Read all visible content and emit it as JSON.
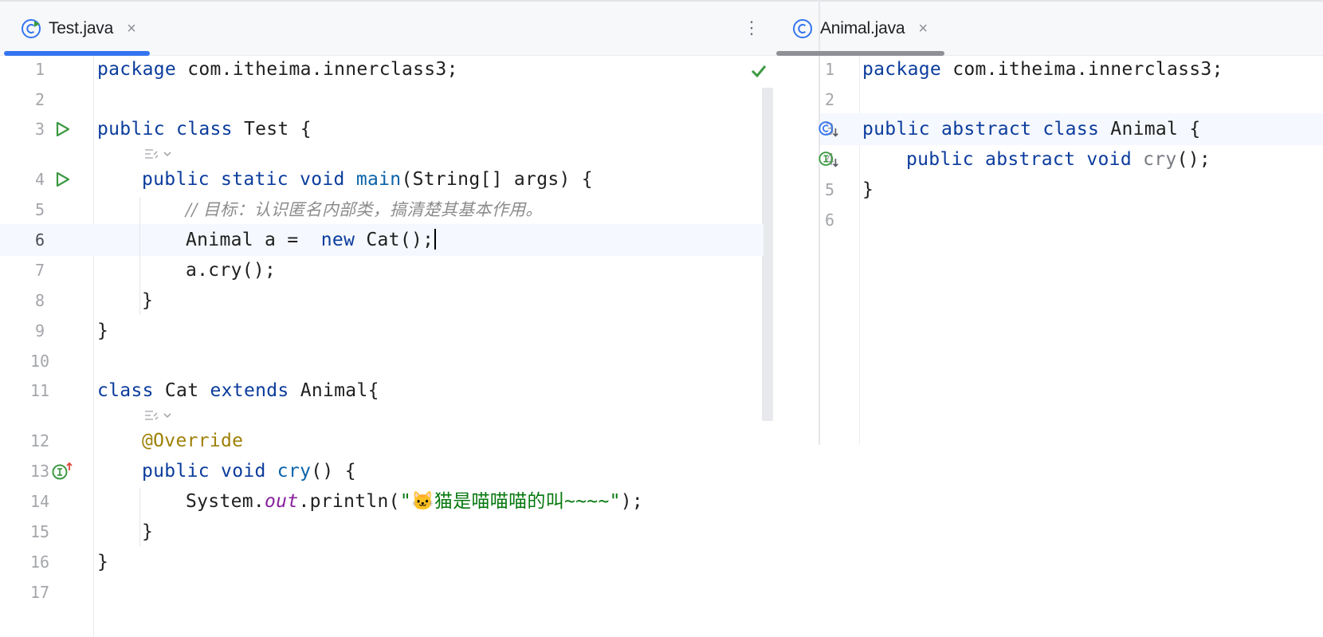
{
  "left_pane": {
    "tab": {
      "label": "Test.java",
      "close": "×",
      "icon": "java-class-runnable-icon",
      "active": true,
      "underline_color": "#3574f0"
    },
    "more_button": "⋮",
    "status_icon": "check-icon",
    "lines": [
      {
        "number": "1",
        "parts": [
          [
            "kw",
            "package"
          ],
          [
            "",
            "com.itheima.innerclass3;"
          ]
        ]
      },
      {
        "number": "2",
        "parts": []
      },
      {
        "number": "3",
        "gutter": "run-icon",
        "parts": [
          [
            "kw",
            "public"
          ],
          [
            "kw",
            "class"
          ],
          [
            "",
            "Test {"
          ]
        ]
      },
      {
        "number": "4",
        "gutter": "run-icon",
        "parts": [
          [
            "kw",
            "public"
          ],
          [
            "kw",
            "static"
          ],
          [
            "kw",
            "void"
          ],
          [
            "fn",
            "main"
          ],
          [
            "",
            "(String[] args) {"
          ]
        ]
      },
      {
        "number": "5",
        "parts": [
          [
            "comment",
            "// 目标：认识匿名内部类，搞清楚其基本作用。"
          ]
        ]
      },
      {
        "number": "6",
        "current": true,
        "parts": [
          [
            "",
            "Animal a = "
          ],
          [
            "kw",
            "new"
          ],
          [
            "",
            "Cat();"
          ]
        ]
      },
      {
        "number": "7",
        "parts": [
          [
            "",
            "a.cry();"
          ]
        ]
      },
      {
        "number": "8",
        "parts": [
          [
            "",
            "}"
          ]
        ]
      },
      {
        "number": "9",
        "parts": [
          [
            "",
            "}"
          ]
        ]
      },
      {
        "number": "10",
        "parts": []
      },
      {
        "number": "11",
        "parts": [
          [
            "kw",
            "class"
          ],
          [
            "",
            "Cat"
          ],
          [
            "kw",
            "extends"
          ],
          [
            "",
            "Animal{"
          ]
        ]
      },
      {
        "number": "12",
        "parts": [
          [
            "anno",
            "@Override"
          ]
        ]
      },
      {
        "number": "13",
        "gutter": "implements-up-icon",
        "parts": [
          [
            "kw",
            "public"
          ],
          [
            "kw",
            "void"
          ],
          [
            "fn",
            "cry"
          ],
          [
            "",
            "() {"
          ]
        ]
      },
      {
        "number": "14",
        "parts": [
          [
            "",
            "System."
          ],
          [
            "fld",
            "out"
          ],
          [
            "",
            ".println("
          ],
          [
            "str",
            "\"🐱猫是喵喵喵的叫~~~~\""
          ],
          [
            "",
            ");"
          ]
        ]
      },
      {
        "number": "15",
        "parts": [
          [
            "",
            "}"
          ]
        ]
      },
      {
        "number": "16",
        "parts": [
          [
            "",
            "}"
          ]
        ]
      },
      {
        "number": "17",
        "parts": []
      }
    ],
    "hints": [
      "ai-assist-icon",
      "ai-assist-icon"
    ]
  },
  "right_pane": {
    "tab": {
      "label": "Animal.java",
      "close": "×",
      "icon": "java-class-icon",
      "active": false,
      "underline_color": "#8e9096"
    },
    "lines": [
      {
        "number": "1",
        "parts": [
          [
            "kw",
            "package"
          ],
          [
            "",
            "com.itheima.innerclass3;"
          ]
        ]
      },
      {
        "number": "2",
        "parts": []
      },
      {
        "number": "3",
        "gutter": "implemented-down-icon",
        "parts": [
          [
            "kw",
            "public"
          ],
          [
            "kw",
            "abstract"
          ],
          [
            "kw",
            "class"
          ],
          [
            "",
            "Animal {"
          ]
        ]
      },
      {
        "number": "4",
        "gutter": "implemented-interface-down-icon",
        "parts": [
          [
            "kw",
            "public"
          ],
          [
            "kw",
            "abstract"
          ],
          [
            "kw",
            "void"
          ],
          [
            "muted",
            "cry"
          ],
          [
            "",
            "();"
          ]
        ]
      },
      {
        "number": "5",
        "parts": [
          [
            "",
            "}"
          ]
        ]
      },
      {
        "number": "6",
        "parts": []
      }
    ]
  },
  "colors": {
    "keyword": "#0b3c9c",
    "function": "#0a63a9",
    "annotation": "#9e8007",
    "string": "#06780e",
    "field": "#861f9c",
    "comment": "#8c8c8c",
    "run_green": "#3d9a43",
    "tab_active": "#3574f0"
  }
}
